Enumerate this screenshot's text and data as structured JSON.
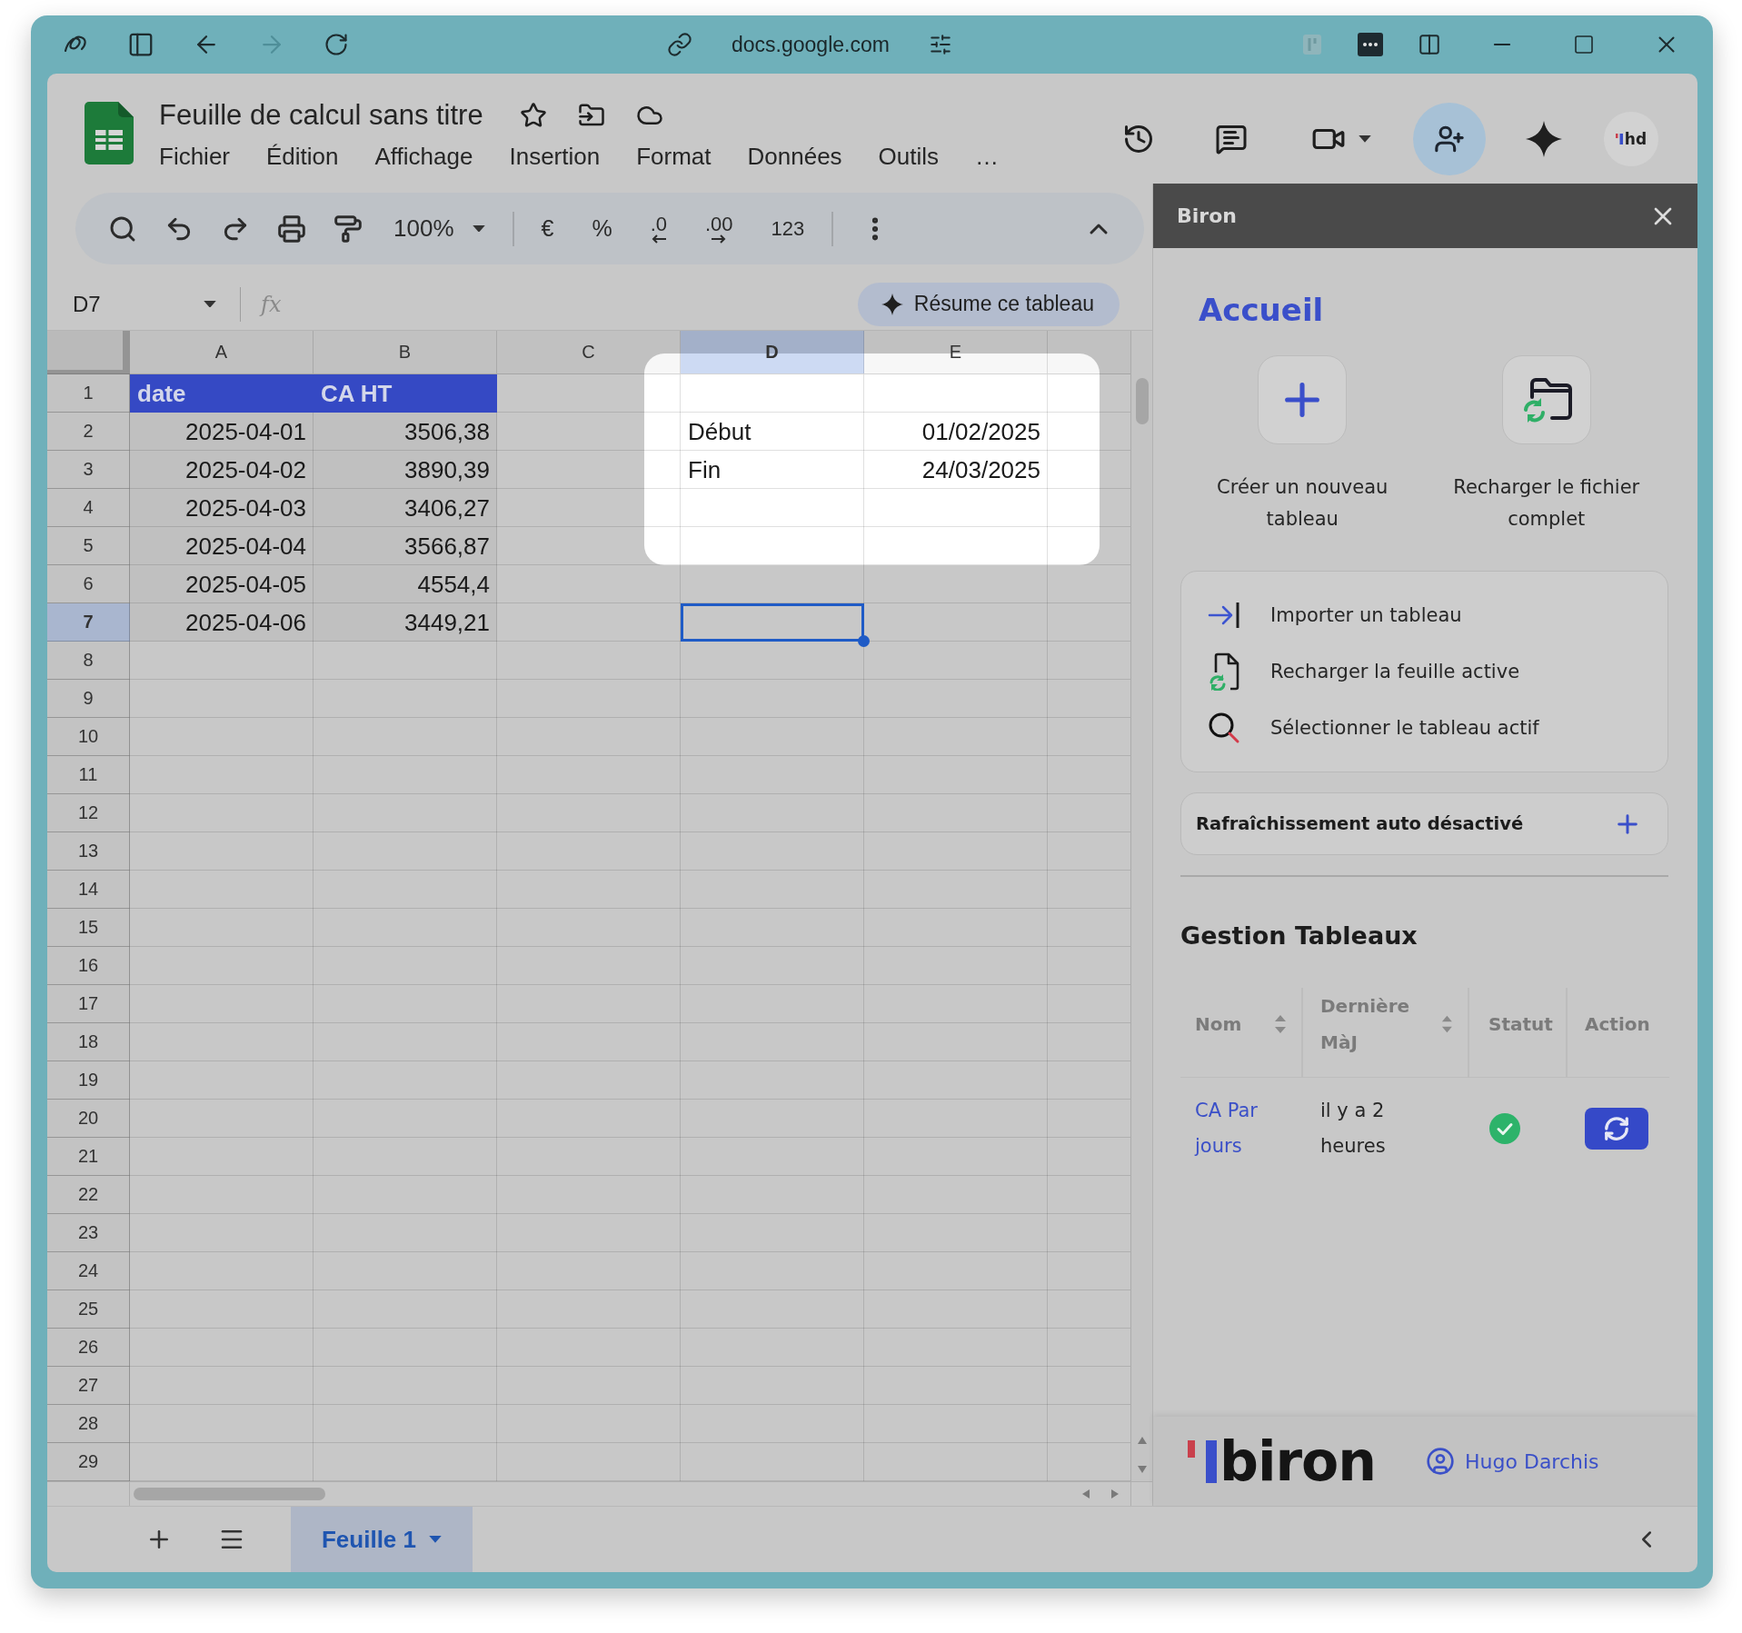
{
  "browser": {
    "address": "docs.google.com",
    "can_go_forward": false
  },
  "document": {
    "title": "Feuille de calcul sans titre",
    "menu": [
      "Fichier",
      "Édition",
      "Affichage",
      "Insertion",
      "Format",
      "Données",
      "Outils",
      "…"
    ],
    "avatar": "hd"
  },
  "toolbar": {
    "zoom": "100%",
    "format_buttons": [
      "€",
      "%",
      ".0",
      ".00",
      "123"
    ]
  },
  "formula_bar": {
    "name_box": "D7",
    "function_label": "fx",
    "summary_button": "Résume ce tableau"
  },
  "sheet": {
    "columns": [
      {
        "label": "A",
        "selected": false
      },
      {
        "label": "B",
        "selected": false
      },
      {
        "label": "C",
        "selected": false
      },
      {
        "label": "D",
        "selected": true
      },
      {
        "label": "E",
        "selected": false
      }
    ],
    "rows": [
      {
        "number": "1",
        "selected": false,
        "cells": [
          {
            "kind": "header",
            "value": "date",
            "highlighted": false
          },
          {
            "kind": "header",
            "value": "CA HT",
            "highlighted": false
          },
          {
            "kind": "blank",
            "highlighted": false
          },
          {
            "kind": "blank",
            "highlighted": true
          },
          {
            "kind": "blank",
            "highlighted": true
          }
        ]
      },
      {
        "number": "2",
        "selected": false,
        "cells": [
          {
            "kind": "data",
            "value": "2025-04-01",
            "highlighted": false
          },
          {
            "kind": "data",
            "value": "3506,38",
            "highlighted": false
          },
          {
            "kind": "blank",
            "highlighted": false
          },
          {
            "kind": "label",
            "value": "Début",
            "highlighted": true
          },
          {
            "kind": "value",
            "value": "01/02/2025",
            "highlighted": true
          }
        ]
      },
      {
        "number": "3",
        "selected": false,
        "cells": [
          {
            "kind": "data",
            "value": "2025-04-02",
            "highlighted": false
          },
          {
            "kind": "data",
            "value": "3890,39",
            "highlighted": false
          },
          {
            "kind": "blank",
            "highlighted": false
          },
          {
            "kind": "label",
            "value": "Fin",
            "highlighted": true
          },
          {
            "kind": "value",
            "value": "24/03/2025",
            "highlighted": true
          }
        ]
      },
      {
        "number": "4",
        "selected": false,
        "cells": [
          {
            "kind": "data",
            "value": "2025-04-03",
            "highlighted": false
          },
          {
            "kind": "data",
            "value": "3406,27",
            "highlighted": false
          },
          {
            "kind": "blank",
            "highlighted": false
          },
          {
            "kind": "blank",
            "highlighted": true
          },
          {
            "kind": "blank",
            "highlighted": true
          }
        ]
      },
      {
        "number": "5",
        "selected": false,
        "cells": [
          {
            "kind": "data",
            "value": "2025-04-04",
            "highlighted": false
          },
          {
            "kind": "data",
            "value": "3566,87",
            "highlighted": false
          },
          {
            "kind": "blank",
            "highlighted": false
          },
          {
            "kind": "blank",
            "highlighted": true
          },
          {
            "kind": "blank",
            "highlighted": true
          }
        ]
      },
      {
        "number": "6",
        "selected": false,
        "cells": [
          {
            "kind": "data",
            "value": "2025-04-05",
            "highlighted": false
          },
          {
            "kind": "data",
            "value": "4554,4",
            "highlighted": false
          }
        ]
      },
      {
        "number": "7",
        "selected": true,
        "cells": [
          {
            "kind": "data",
            "value": "2025-04-06",
            "highlighted": false
          },
          {
            "kind": "data",
            "value": "3449,21",
            "highlighted": false
          }
        ]
      },
      {
        "number": "8",
        "selected": false
      },
      {
        "number": "9",
        "selected": false
      },
      {
        "number": "10",
        "selected": false
      },
      {
        "number": "11",
        "selected": false
      },
      {
        "number": "12",
        "selected": false
      },
      {
        "number": "13",
        "selected": false
      },
      {
        "number": "14",
        "selected": false
      },
      {
        "number": "15",
        "selected": false
      },
      {
        "number": "16",
        "selected": false
      },
      {
        "number": "17",
        "selected": false
      },
      {
        "number": "18",
        "selected": false
      },
      {
        "number": "19",
        "selected": false
      },
      {
        "number": "20",
        "selected": false
      },
      {
        "number": "21",
        "selected": false
      },
      {
        "number": "22",
        "selected": false
      },
      {
        "number": "23",
        "selected": false
      },
      {
        "number": "24",
        "selected": false
      },
      {
        "number": "25",
        "selected": false
      },
      {
        "number": "26",
        "selected": false
      },
      {
        "number": "27",
        "selected": false
      },
      {
        "number": "28",
        "selected": false
      },
      {
        "number": "29",
        "selected": false
      }
    ]
  },
  "sheet_tabs": [
    {
      "label": "Feuille 1",
      "selected": true
    }
  ],
  "sidebar": {
    "title": "Biron",
    "heading": "Accueil",
    "tiles": [
      "Créer un nouveau tableau",
      "Recharger le fichier complet"
    ],
    "actions": [
      "Importer un tableau",
      "Recharger la feuille active",
      "Sélectionner le tableau actif"
    ],
    "auto_refresh": "Rafraîchissement auto désactivé",
    "tables": {
      "title": "Gestion Tableaux",
      "columns": [
        {
          "label": "Nom",
          "sortable": true
        },
        {
          "label": "Dernière MàJ",
          "sortable": true
        },
        {
          "label": "Statut",
          "sortable": false
        },
        {
          "label": "Action",
          "sortable": false
        }
      ],
      "rows": [
        {
          "name": "CA Par jours",
          "updated": "il y a 2 heures",
          "synced": true
        }
      ]
    },
    "logo": "biron",
    "user": "Hugo Darchis"
  }
}
